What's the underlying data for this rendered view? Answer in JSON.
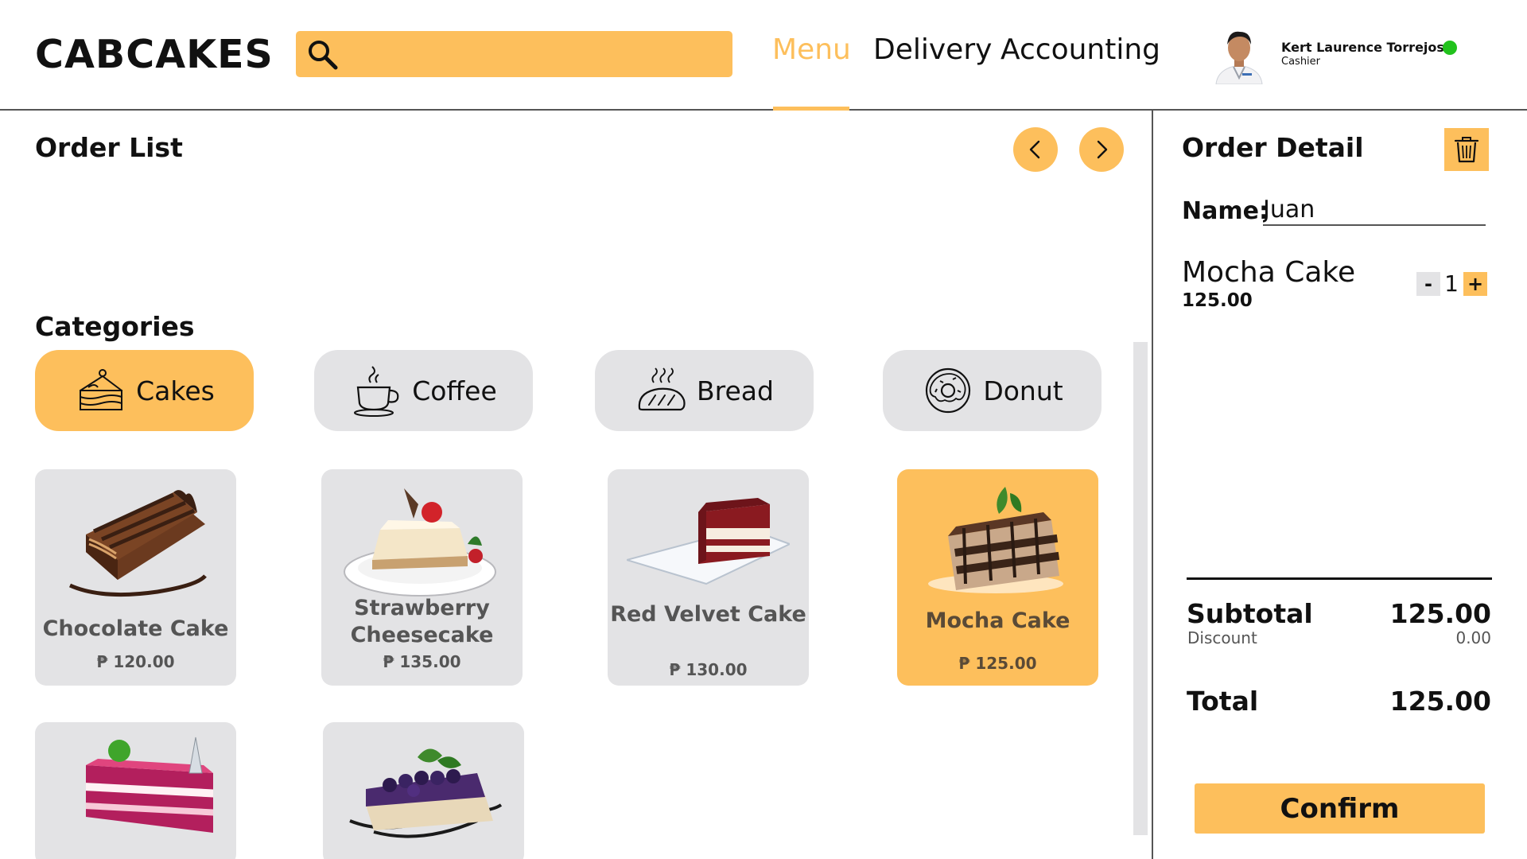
{
  "app": {
    "brand": "CABCAKES"
  },
  "search": {
    "value": "",
    "placeholder": ""
  },
  "nav": {
    "menu": "Menu",
    "delivery": "Delivery",
    "accounting": "Accounting",
    "active": "Menu"
  },
  "user": {
    "name": "Kert Laurence Torrejos",
    "role": "Cashier",
    "status": "online"
  },
  "order_list": {
    "title": "Order List"
  },
  "categories": {
    "title": "Categories",
    "items": [
      {
        "label": "Cakes",
        "icon": "cake-slice-icon",
        "active": true
      },
      {
        "label": "Coffee",
        "icon": "coffee-cup-icon",
        "active": false
      },
      {
        "label": "Bread",
        "icon": "bread-icon",
        "active": false
      },
      {
        "label": "Donut",
        "icon": "donut-icon",
        "active": false
      }
    ]
  },
  "products": [
    {
      "name": "Chocolate Cake",
      "price": "₱ 120.00",
      "selected": false
    },
    {
      "name_line1": "Strawberry",
      "name_line2": "Cheesecake",
      "price": "₱ 135.00",
      "selected": false
    },
    {
      "name": "Red Velvet Cake",
      "price": "₱ 130.00",
      "selected": false
    },
    {
      "name": "Mocha Cake",
      "price": "₱ 125.00",
      "selected": true
    },
    {
      "name": "",
      "price": "",
      "selected": false
    },
    {
      "name": "",
      "price": "",
      "selected": false
    }
  ],
  "order_detail": {
    "title": "Order Detail",
    "name_label": "Name:",
    "customer_name": "Juan",
    "items": [
      {
        "name": "Mocha Cake",
        "price": "125.00",
        "qty": "1"
      }
    ],
    "minus_label": "-",
    "plus_label": "+",
    "subtotal_label": "Subtotal",
    "subtotal": "125.00",
    "discount_label": "Discount",
    "discount": "0.00",
    "total_label": "Total",
    "total": "125.00",
    "confirm_label": "Confirm"
  },
  "colors": {
    "accent": "#fdbf5c",
    "card_bg": "#e3e3e5",
    "online": "#22c21d",
    "text": "#111111"
  }
}
